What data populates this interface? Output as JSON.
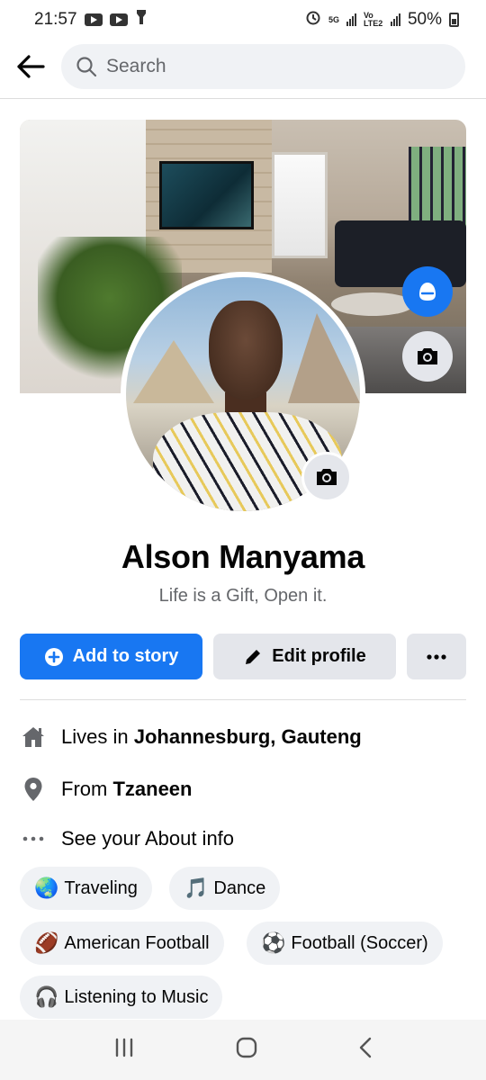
{
  "status_bar": {
    "time": "21:57",
    "network": "5G",
    "volte": "Vo LTE2",
    "battery": "50%"
  },
  "search": {
    "placeholder": "Search"
  },
  "profile": {
    "name": "Alson Manyama",
    "bio": "Life is a Gift, Open it."
  },
  "actions": {
    "add_story": "Add to story",
    "edit_profile": "Edit profile",
    "more": "..."
  },
  "intro": {
    "lives_prefix": "Lives in ",
    "lives_place": "Johannesburg, Gauteng",
    "from_prefix": "From ",
    "from_place": "Tzaneen",
    "about_link": "See your About info"
  },
  "hobbies": [
    {
      "emoji": "🌏",
      "label": "Traveling"
    },
    {
      "emoji": "🎵",
      "label": "Dance"
    },
    {
      "emoji": "🏈",
      "label": "American Football"
    },
    {
      "emoji": "⚽",
      "label": "Football (Soccer)"
    },
    {
      "emoji": "🎧",
      "label": "Listening to Music"
    }
  ],
  "colors": {
    "accent": "#1877f2",
    "secondary_bg": "#e4e6eb",
    "muted_text": "#65676b"
  }
}
